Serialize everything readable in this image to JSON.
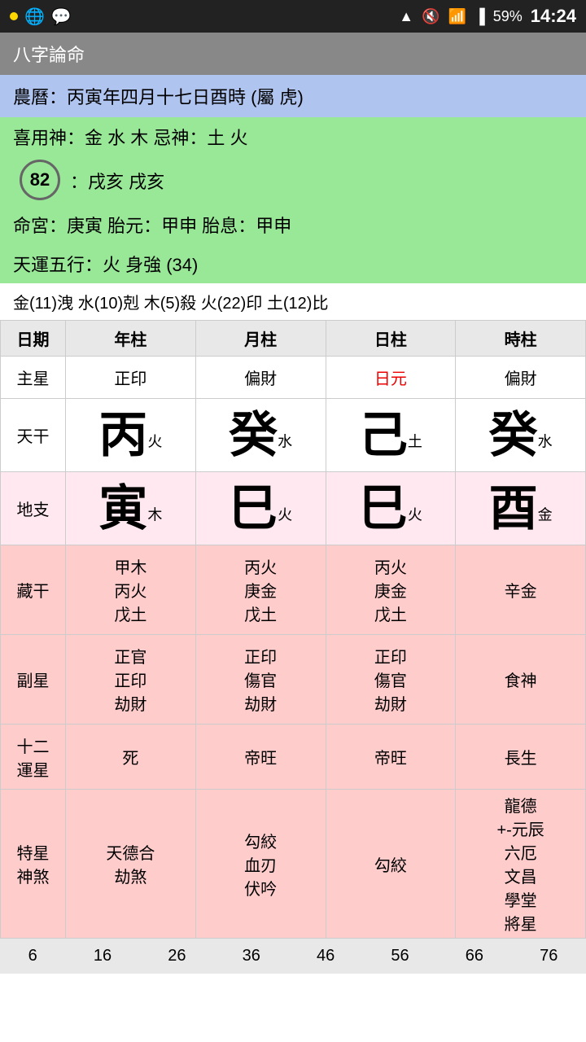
{
  "statusBar": {
    "battery": "59%",
    "time": "14:24"
  },
  "appBar": {
    "title": "八字論命"
  },
  "info": {
    "lunar": "農曆：丙寅年四月十七日酉時 (屬 虎)",
    "shenyong": "喜用神：金 水 木          忌神：土 火",
    "badge": "82",
    "shen2": "：戌亥 戌亥",
    "ming": "命宮：庚寅    胎元：甲申    胎息：甲申",
    "tianyun": "天運五行：火               身強 (34)",
    "wuxing": "金(11)洩  水(10)剋  木(5)殺  火(22)印  土(12)比"
  },
  "table": {
    "headers": [
      "日期",
      "年柱",
      "月柱",
      "日柱",
      "時柱"
    ],
    "zhuxing": {
      "label": "主星",
      "cols": [
        "正印",
        "偏財",
        "日元",
        "偏財"
      ],
      "redCol": 2
    },
    "tiangan": {
      "label": "天干",
      "cols": [
        {
          "big": "丙",
          "small": "火"
        },
        {
          "big": "癸",
          "small": "水"
        },
        {
          "big": "己",
          "small": "土"
        },
        {
          "big": "癸",
          "small": "水"
        }
      ]
    },
    "dizhi": {
      "label": "地支",
      "cols": [
        {
          "big": "寅",
          "small": "木"
        },
        {
          "big": "巳",
          "small": "火"
        },
        {
          "big": "巳",
          "small": "火"
        },
        {
          "big": "酉",
          "small": "金"
        }
      ]
    },
    "zanggan": {
      "label": "藏干",
      "cols": [
        "甲木\n丙火\n戊土",
        "丙火\n庚金\n戊土",
        "丙火\n庚金\n戊土",
        "辛金"
      ]
    },
    "fuxing": {
      "label": "副星",
      "cols": [
        "正官\n正印\n劫財",
        "正印\n傷官\n劫財",
        "正印\n傷官\n劫財",
        "食神"
      ]
    },
    "shier": {
      "label": "十二\n運星",
      "cols": [
        "死",
        "帝旺",
        "帝旺",
        "長生"
      ]
    },
    "texing": {
      "label": "特星\n神煞",
      "cols": [
        "天德合\n劫煞",
        "勾絞\n血刃\n伏吟",
        "勾絞",
        "龍德\n+-元辰\n六厄\n文昌\n學堂\n將星"
      ]
    }
  },
  "bottomNums": [
    "6",
    "16",
    "26",
    "36",
    "46",
    "56",
    "66",
    "76"
  ]
}
